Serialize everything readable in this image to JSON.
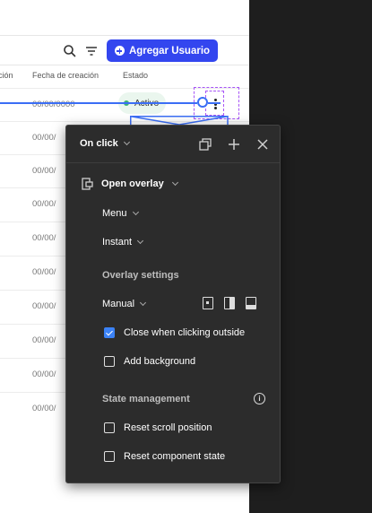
{
  "canvas": {
    "add_user_label": "Agregar Usuario",
    "columns": {
      "cut": "ción",
      "date": "Fecha de creación",
      "status": "Estado"
    },
    "rows": [
      {
        "date": "00/00/0000",
        "status": "Activo"
      },
      {
        "date": "00/00/"
      },
      {
        "date": "00/00/"
      },
      {
        "date": "00/00/"
      },
      {
        "date": "00/00/"
      },
      {
        "date": "00/00/"
      },
      {
        "date": "00/00/"
      },
      {
        "date": "00/00/"
      },
      {
        "date": "00/00/"
      },
      {
        "date": "00/00/"
      }
    ]
  },
  "panel": {
    "trigger": "On click",
    "action": "Open overlay",
    "destination": "Menu",
    "animation": "Instant",
    "overlay_settings_label": "Overlay settings",
    "position": "Manual",
    "close_outside": {
      "label": "Close when clicking outside",
      "checked": true
    },
    "add_background": {
      "label": "Add background",
      "checked": false
    },
    "state_management_label": "State management",
    "reset_scroll": {
      "label": "Reset scroll position",
      "checked": false
    },
    "reset_component": {
      "label": "Reset component state",
      "checked": false
    }
  },
  "colors": {
    "accent_blue": "#3346ef",
    "prototype_blue": "#3b6ef5",
    "status_green": "#3cb371",
    "panel_bg": "#2c2c2c",
    "checkbox_blue": "#3b82f6"
  }
}
